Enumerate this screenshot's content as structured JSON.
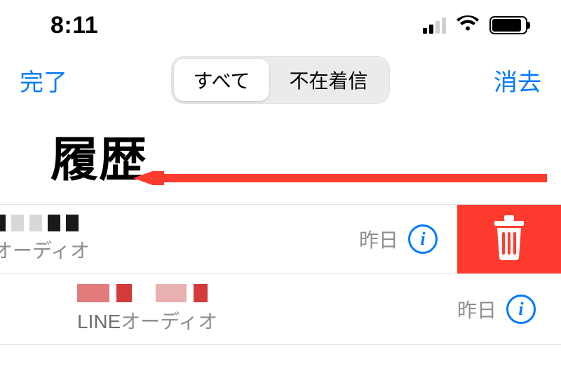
{
  "status": {
    "time": "8:11"
  },
  "nav": {
    "done": "完了",
    "clear": "消去",
    "segment": {
      "all": "すべて",
      "missed": "不在着信"
    }
  },
  "title": "履歴",
  "rows": [
    {
      "subtype": "オーディオ",
      "time": "昨日"
    },
    {
      "prefix": "LINE",
      "subtype": "オーディオ",
      "time": "昨日"
    }
  ],
  "colors": {
    "accent": "#007aff",
    "delete": "#ff3b30"
  }
}
